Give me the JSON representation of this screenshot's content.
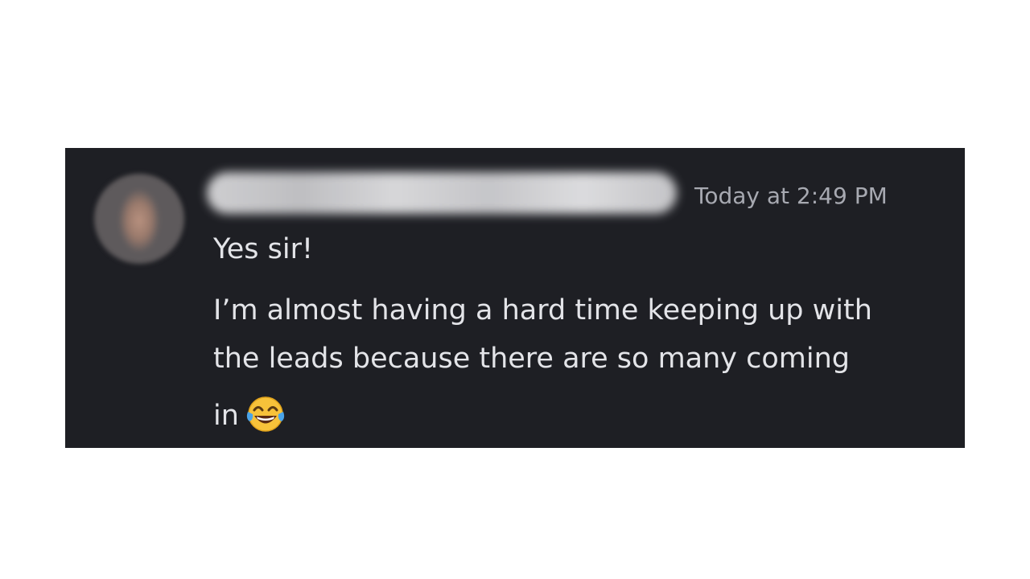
{
  "message": {
    "timestamp": "Today at 2:49 PM",
    "lines": [
      "Yes sir!",
      "I’m almost having a hard time keeping up with",
      "the leads because there are so many coming",
      "in"
    ],
    "emoji": "face-with-tears-of-joy-icon"
  }
}
